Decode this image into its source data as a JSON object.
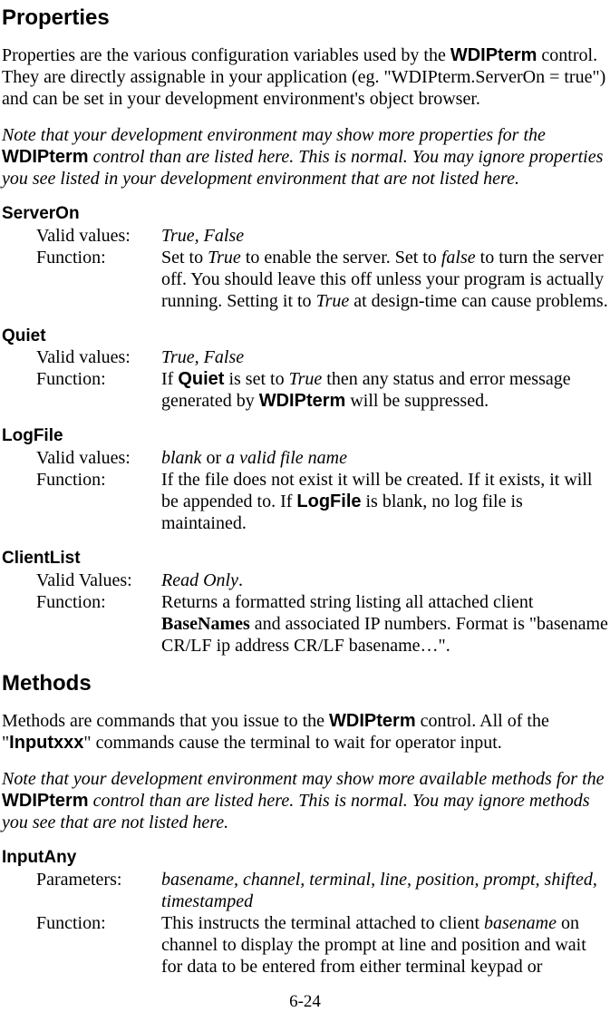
{
  "page_number": "6-24",
  "properties_heading": "Properties",
  "properties_intro_a": "Properties are the various configuration variables used by the ",
  "properties_intro_bold1": "WDIPterm",
  "properties_intro_b": " control. They are directly assignable in your application (eg. \"WDIPterm.ServerOn = true\") and can be set in your development environment's object browser.",
  "properties_note_a": "Note that your development environment may show more properties for the ",
  "properties_note_bold": "WDIPterm",
  "properties_note_b": " control than are listed here. This is normal. You may ignore pro­perties you see listed in your development environment that are not listed here.",
  "label_valid_values": "Valid values:",
  "label_valid_values_cap": "Valid Values:",
  "label_function": "Function:",
  "label_parameters": "Parameters:",
  "serveron_name": "ServerOn",
  "serveron_vals": "True, False",
  "serveron_func_a": "Set to ",
  "serveron_func_i1": "True",
  "serveron_func_b": " to enable the server. Set to ",
  "serveron_func_i2": "false",
  "serveron_func_c": " to turn the server off. You should leave this off unless your program is actually running. Setting it to ",
  "serveron_func_i3": "True",
  "serveron_func_d": " at design-time can cause problems.",
  "quiet_name": "Quiet",
  "quiet_vals": "True, False",
  "quiet_func_a": "If ",
  "quiet_func_bold1": "Quiet",
  "quiet_func_b": " is set to ",
  "quiet_func_i1": "True",
  "quiet_func_c": " then any status and error message generated by ",
  "quiet_func_bold2": "WDIPterm",
  "quiet_func_d": " will be suppressed.",
  "logfile_name": "LogFile",
  "logfile_vals_i1": "blank",
  "logfile_vals_a": " or ",
  "logfile_vals_i2": "a valid file name",
  "logfile_func_a": "If the file does not exist it will be created. If it exists, it will be appended to. If ",
  "logfile_func_bold": "LogFile",
  "logfile_func_b": " is blank, no log file is maintained.",
  "clientlist_name": "ClientList",
  "clientlist_vals_i": "Read Only",
  "clientlist_vals_dot": ".",
  "clientlist_func_a": "Returns a formatted string listing all attached client ",
  "clientlist_func_bold": "BaseNames",
  "clientlist_func_b": " and associated IP numbers. Format is \"basename CR/LF ip address CR/LF basename…\".",
  "methods_heading": "Methods",
  "methods_intro_a": "Methods are commands that you issue to the ",
  "methods_intro_bold1": "WDIPterm",
  "methods_intro_b": " control. All of the \"",
  "methods_intro_bold2": "Inputxxx",
  "methods_intro_c": "\" commands cause the terminal to wait for operator input.",
  "methods_note_a": "Note that your development environment may show more available methods for the ",
  "methods_note_bold": "WDIPterm",
  "methods_note_b": " control than are listed here. This is normal. You may ignore methods you see that are not listed here.",
  "inputany_name": "InputAny",
  "inputany_params": "basename, channel, terminal, line, position, prompt, shifted, timestamped",
  "inputany_func_a": "This instructs the terminal attached to client ",
  "inputany_func_i1": "basename",
  "inputany_func_b": " on channel to display the prompt at line and position and wait for data to be entered from either terminal keypad or"
}
